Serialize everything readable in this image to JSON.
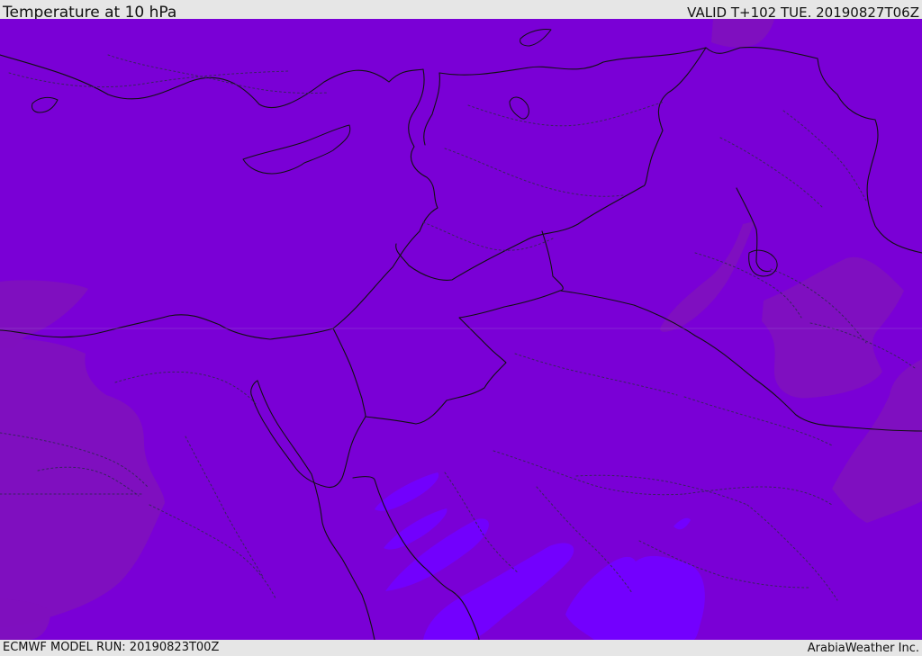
{
  "header": {
    "title": "Temperature at 10 hPa",
    "valid_time": "VALID T+102 TUE. 20190827T06Z"
  },
  "footer": {
    "model_run": "ECMWF MODEL RUN: 20190823T00Z",
    "brand": "ArabiaWeather Inc."
  },
  "map": {
    "colors": {
      "base_fill": "#7a00d6",
      "warm_fill": "#7f10be",
      "cool_fill": "#7200ff",
      "border_line": "#111111",
      "dotted_line": "#3a2360"
    }
  }
}
